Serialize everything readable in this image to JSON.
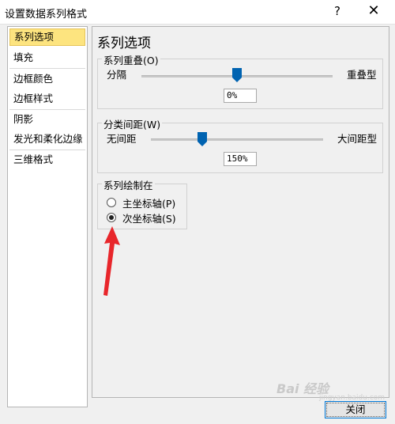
{
  "window": {
    "title": "设置数据系列格式",
    "help_symbol": "?",
    "close_symbol": "✕"
  },
  "sidebar": {
    "items": [
      {
        "label": "系列选项",
        "selected": true
      },
      {
        "label": "填充"
      },
      {
        "label": "边框颜色"
      },
      {
        "label": "边框样式"
      },
      {
        "label": "阴影"
      },
      {
        "label": "发光和柔化边缘"
      },
      {
        "label": "三维格式"
      }
    ]
  },
  "main": {
    "title": "系列选项",
    "overlap": {
      "label": "系列重叠(O)",
      "min_label": "分隔",
      "max_label": "重叠型",
      "value": "0%",
      "level_fraction": 0.5
    },
    "gap": {
      "label": "分类间距(W)",
      "min_label": "无间距",
      "max_label": "大间距型",
      "value": "150%",
      "level_fraction": 0.3
    },
    "plot_on": {
      "label": "系列绘制在",
      "options": [
        {
          "label": "主坐标轴(P)",
          "checked": false
        },
        {
          "label": "次坐标轴(S)",
          "checked": true
        }
      ]
    }
  },
  "footer": {
    "close_label": "关闭"
  },
  "watermark": {
    "text": "Bai 经验",
    "sub": "jingyan.baidu.com"
  },
  "colors": {
    "selected_bg": "#fde47f",
    "slider_thumb": "#0063b1",
    "annotation_arrow": "#e8262b"
  }
}
